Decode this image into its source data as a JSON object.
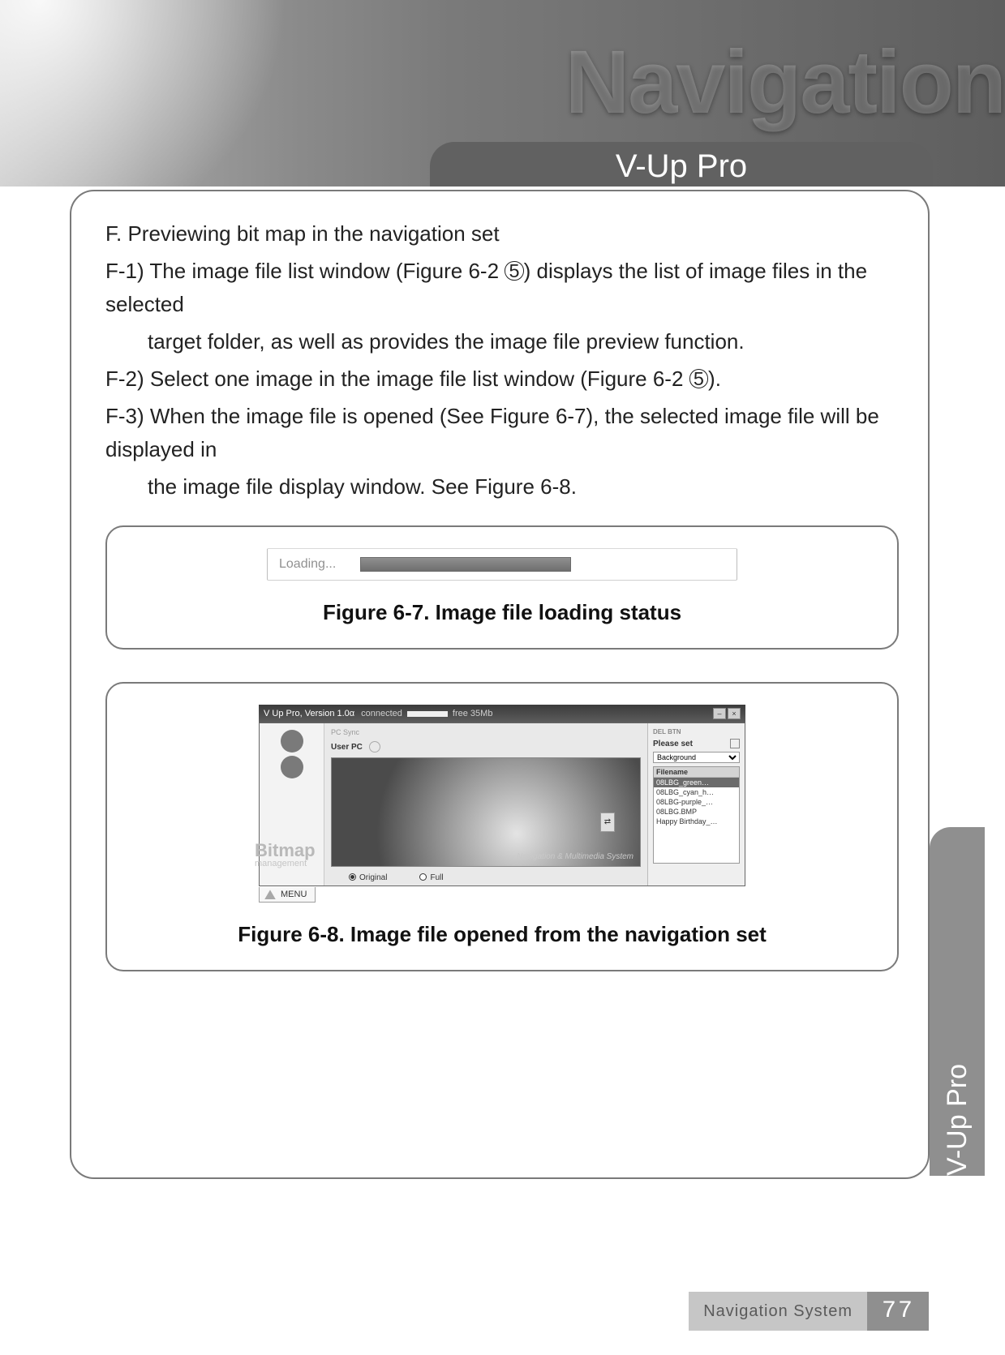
{
  "banner": {
    "watermark": "Navigation",
    "tab": "V-Up Pro"
  },
  "content": {
    "heading": "F. Previewing bit map in the navigation set",
    "f1a": "F-1) The image file list window (Figure 6-2  ",
    "f1_num": "5",
    "f1b": ") displays the list of image files in the selected",
    "f1c": "target folder, as well as provides the image file preview function.",
    "f2a": "F-2) Select one image in the image file list window (Figure 6-2  ",
    "f2_num": "5",
    "f2b": ").",
    "f3a": "F-3) When the image file is opened (See Figure 6-7), the selected image file will be displayed in",
    "f3b": "the image file display window. See Figure 6-8."
  },
  "fig67": {
    "loading": "Loading...",
    "caption": "Figure 6-7. Image file loading status"
  },
  "fig68": {
    "title": "V Up Pro, Version 1.0α",
    "status": "connected",
    "free": "free 35Mb",
    "userpc": "User PC",
    "pcsync": "PC Sync",
    "please": "Please set",
    "delbtn": "DEL BTN",
    "dropdown": "Background",
    "filehdr": "Filename",
    "files": [
      "08LBG_green…",
      "08LBG_cyan_h…",
      "08LBG-purple_…",
      "08LBG.BMP",
      "Happy Birthday_…"
    ],
    "watermark": "Navigation & Multimedia System",
    "original": "Original",
    "full": "Full",
    "menu": "MENU",
    "sidelabel_top": "Bitmap",
    "sidelabel_bot": "management",
    "arrow": "⇄",
    "caption": "Figure 6-8. Image file opened from the navigation set"
  },
  "sidetab": "V-Up Pro",
  "footer": {
    "label": "Navigation System",
    "page": "77"
  }
}
